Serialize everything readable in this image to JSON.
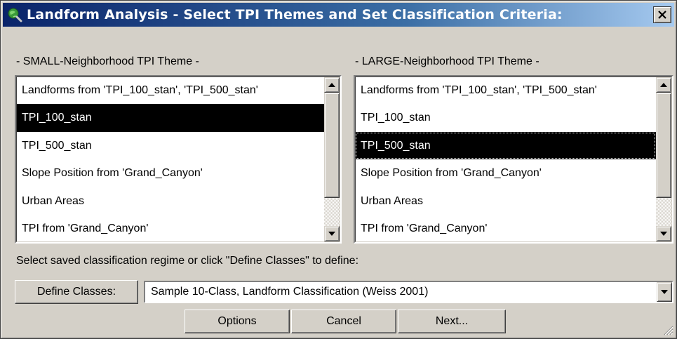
{
  "window": {
    "title": "Landform Analysis - Select TPI Themes and Set Classification Criteria:",
    "close_label": "✕"
  },
  "small_list": {
    "label": "- SMALL-Neighborhood TPI Theme -",
    "items": [
      {
        "label": "Landforms from 'TPI_100_stan', 'TPI_500_stan'"
      },
      {
        "label": "TPI_100_stan"
      },
      {
        "label": "TPI_500_stan"
      },
      {
        "label": "Slope Position from 'Grand_Canyon'"
      },
      {
        "label": "Urban Areas"
      },
      {
        "label": "TPI from 'Grand_Canyon'"
      }
    ],
    "selected": "TPI_100_stan"
  },
  "large_list": {
    "label": "- LARGE-Neighborhood TPI Theme -",
    "items": [
      {
        "label": "Landforms from 'TPI_100_stan', 'TPI_500_stan'"
      },
      {
        "label": "TPI_100_stan"
      },
      {
        "label": "TPI_500_stan"
      },
      {
        "label": "Slope Position from 'Grand_Canyon'"
      },
      {
        "label": "Urban Areas"
      },
      {
        "label": "TPI from 'Grand_Canyon'"
      }
    ],
    "selected": "TPI_500_stan"
  },
  "classification": {
    "instruction": "Select saved classification regime or click \"Define Classes\" to define:",
    "define_button": "Define Classes:",
    "selected_regime": "Sample 10-Class, Landform Classification (Weiss 2001)"
  },
  "buttons": {
    "options": "Options",
    "cancel": "Cancel",
    "next": "Next..."
  },
  "colors": {
    "title_gradient_start": "#0a246a",
    "title_gradient_end": "#a6caf0",
    "dialog_face": "#d4d0c8",
    "selection": "#000000"
  }
}
